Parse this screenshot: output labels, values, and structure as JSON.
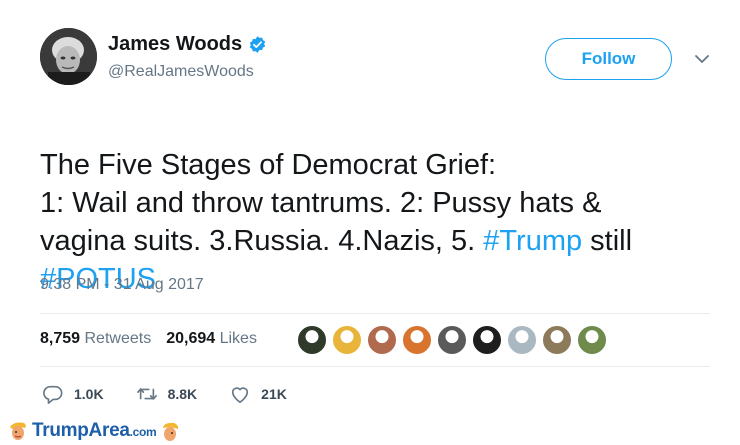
{
  "author": {
    "display_name": "James Woods",
    "handle": "@RealJamesWoods",
    "verified_icon": "verified-badge-icon"
  },
  "header": {
    "follow_label": "Follow",
    "more_icon": "chevron-down-icon"
  },
  "tweet": {
    "text_segments": [
      {
        "text": "The Five Stages of Democrat Grief:\n1: Wail and throw tantrums. 2: Pussy hats  &\nvagina suits. 3.Russia. 4.Nazis, 5. ",
        "hashtag": false
      },
      {
        "text": "#Trump",
        "hashtag": true
      },
      {
        "text": " still\n",
        "hashtag": false
      },
      {
        "text": "#POTUS",
        "hashtag": true
      }
    ],
    "timestamp": "9:38 PM - 31 Aug 2017"
  },
  "stats": {
    "retweets_count": "8,759",
    "retweets_label": "Retweets",
    "likes_count": "20,694",
    "likes_label": "Likes"
  },
  "liker_avatars": [
    {
      "name": "liker-1",
      "color": "#2f3a2a"
    },
    {
      "name": "liker-2",
      "color": "#e9b43a"
    },
    {
      "name": "liker-3",
      "color": "#b06a4e"
    },
    {
      "name": "liker-4",
      "color": "#d9742f"
    },
    {
      "name": "liker-5",
      "color": "#5a5a5a"
    },
    {
      "name": "liker-6",
      "color": "#1e1e1e"
    },
    {
      "name": "liker-7",
      "color": "#aab8c2"
    },
    {
      "name": "liker-8",
      "color": "#8c7a5b"
    },
    {
      "name": "liker-9",
      "color": "#6f8a4a"
    }
  ],
  "actions": {
    "reply_count": "1.0K",
    "retweet_count": "8.8K",
    "like_count": "21K"
  },
  "watermark": {
    "brand": "TrumpArea",
    "suffix": ".com"
  },
  "colors": {
    "accent": "#1da1f2",
    "text": "#14171a",
    "secondary": "#657786",
    "watermark": "#1d5fa8"
  }
}
